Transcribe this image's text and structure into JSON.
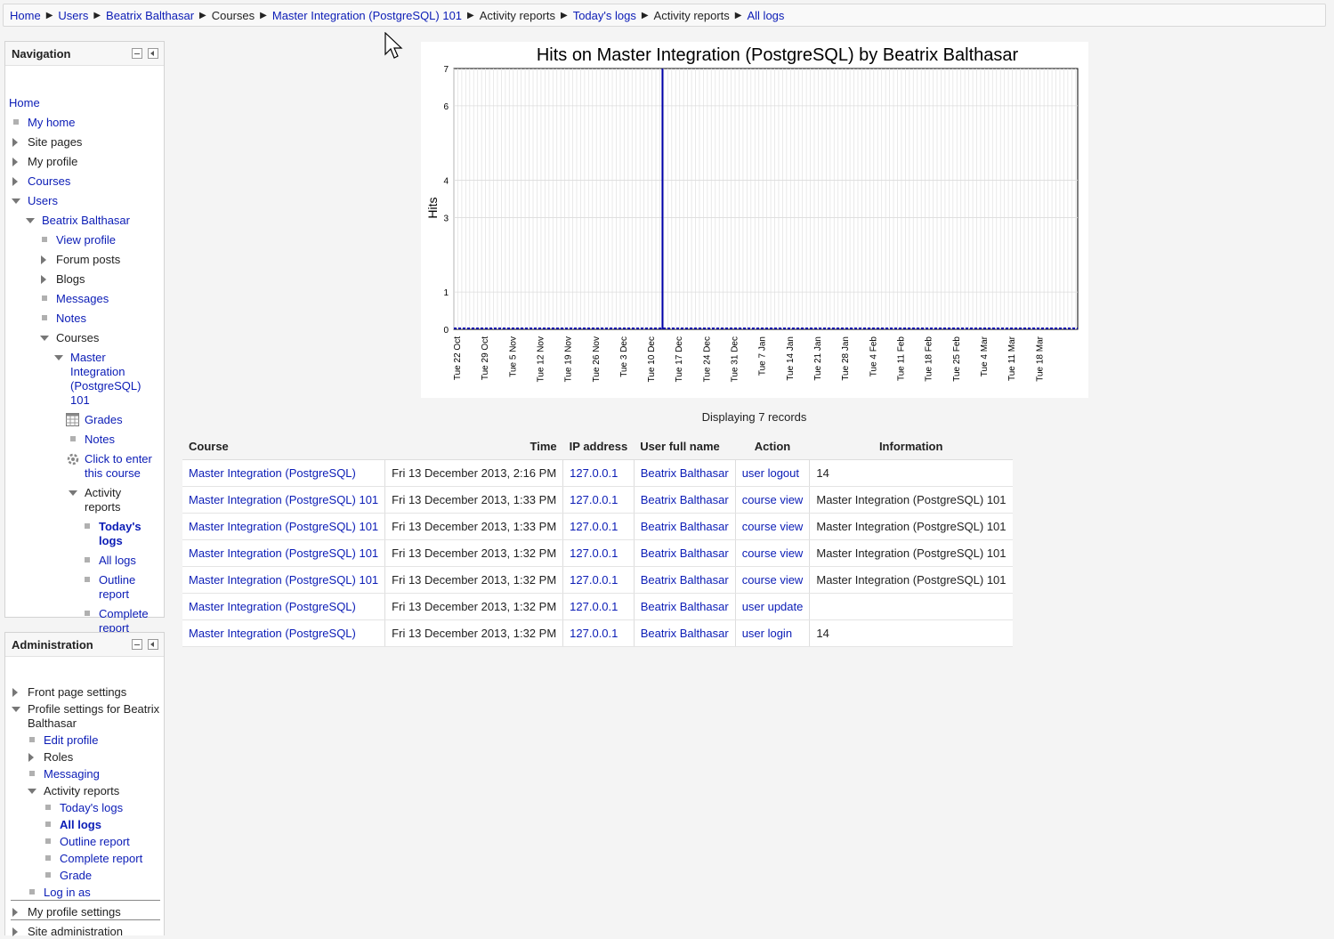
{
  "breadcrumb": [
    {
      "label": "Home",
      "link": true
    },
    {
      "label": "Users",
      "link": true
    },
    {
      "label": "Beatrix Balthasar",
      "link": true
    },
    {
      "label": "Courses",
      "link": false
    },
    {
      "label": "Master Integration (PostgreSQL) 101",
      "link": true
    },
    {
      "label": "Activity reports",
      "link": false
    },
    {
      "label": "Today's logs",
      "link": true
    },
    {
      "label": "Activity reports",
      "link": false
    },
    {
      "label": "All logs",
      "link": true
    }
  ],
  "navigation": {
    "title": "Navigation",
    "home": "Home",
    "items": [
      {
        "label": "My home",
        "marker": "square",
        "depth": 0,
        "link": true
      },
      {
        "label": "Site pages",
        "marker": "right",
        "depth": 0,
        "link": false
      },
      {
        "label": "My profile",
        "marker": "right",
        "depth": 0,
        "link": false
      },
      {
        "label": "Courses",
        "marker": "right",
        "depth": 0,
        "link": true
      },
      {
        "label": "Users",
        "marker": "down",
        "depth": 0,
        "link": true
      },
      {
        "label": "Beatrix Balthasar",
        "marker": "down",
        "depth": 1,
        "link": true
      },
      {
        "label": "View profile",
        "marker": "square",
        "depth": 2,
        "link": true
      },
      {
        "label": "Forum posts",
        "marker": "right",
        "depth": 2,
        "link": false
      },
      {
        "label": "Blogs",
        "marker": "right",
        "depth": 2,
        "link": false
      },
      {
        "label": "Messages",
        "marker": "square",
        "depth": 2,
        "link": true
      },
      {
        "label": "Notes",
        "marker": "square",
        "depth": 2,
        "link": true
      },
      {
        "label": "Courses",
        "marker": "down",
        "depth": 2,
        "link": false
      },
      {
        "label": "Master Integration (PostgreSQL) 101",
        "marker": "down",
        "depth": 3,
        "link": true,
        "lines": [
          "Master",
          "Integration",
          "(PostgreSQL)",
          "101"
        ]
      },
      {
        "label": "Grades",
        "marker": "grid",
        "depth": 4,
        "link": true
      },
      {
        "label": "Notes",
        "marker": "square",
        "depth": 4,
        "link": true
      },
      {
        "label": "Click to enter this course",
        "marker": "gear",
        "depth": 4,
        "link": true,
        "lines": [
          "Click to enter",
          "this course"
        ]
      },
      {
        "label": "Activity reports",
        "marker": "down",
        "depth": 4,
        "link": false,
        "lines": [
          "Activity",
          "reports"
        ]
      },
      {
        "label": "Today's logs",
        "marker": "square",
        "depth": 5,
        "link": true,
        "bold": true,
        "lines": [
          "Today's",
          "logs"
        ]
      },
      {
        "label": "All logs",
        "marker": "square",
        "depth": 5,
        "link": true
      },
      {
        "label": "Outline report",
        "marker": "square",
        "depth": 5,
        "link": true,
        "lines": [
          "Outline",
          "report"
        ]
      },
      {
        "label": "Complete report",
        "marker": "square",
        "depth": 5,
        "link": true,
        "lines": [
          "Complete",
          "report"
        ]
      }
    ]
  },
  "administration": {
    "title": "Administration",
    "items": [
      {
        "label": "Front page settings",
        "marker": "right",
        "depth": 0,
        "link": false
      },
      {
        "label": "Profile settings for Beatrix Balthasar",
        "marker": "down",
        "depth": 0,
        "link": false,
        "lines": [
          "Profile settings for Beatrix",
          "Balthasar"
        ]
      },
      {
        "label": "Edit profile",
        "marker": "square",
        "depth": 1,
        "link": true
      },
      {
        "label": "Roles",
        "marker": "right",
        "depth": 1,
        "link": false
      },
      {
        "label": "Messaging",
        "marker": "square",
        "depth": 1,
        "link": true
      },
      {
        "label": "Activity reports",
        "marker": "down",
        "depth": 1,
        "link": false
      },
      {
        "label": "Today's logs",
        "marker": "square",
        "depth": 2,
        "link": true
      },
      {
        "label": "All logs",
        "marker": "square",
        "depth": 2,
        "link": true,
        "bold": true
      },
      {
        "label": "Outline report",
        "marker": "square",
        "depth": 2,
        "link": true
      },
      {
        "label": "Complete report",
        "marker": "square",
        "depth": 2,
        "link": true
      },
      {
        "label": "Grade",
        "marker": "square",
        "depth": 2,
        "link": true
      },
      {
        "label": "Log in as",
        "marker": "square",
        "depth": 1,
        "link": true
      },
      {
        "label": "My profile settings",
        "marker": "right",
        "depth": 0,
        "link": false
      },
      {
        "label": "Site administration",
        "marker": "right",
        "depth": 0,
        "link": false
      }
    ]
  },
  "chart_data": {
    "type": "bar",
    "title": "Hits on Master Integration (PostgreSQL) by Beatrix Balthasar",
    "ylabel": "Hits",
    "xlabel": "",
    "ylim": [
      0,
      7
    ],
    "yticks": [
      0,
      1,
      3,
      4,
      6,
      7
    ],
    "tick_labels": [
      "Tue 22 Oct",
      "Tue 29 Oct",
      "Tue 5 Nov",
      "Tue 12 Nov",
      "Tue 19 Nov",
      "Tue 26 Nov",
      "Tue 3 Dec",
      "Tue 10 Dec",
      "Tue 17 Dec",
      "Tue 24 Dec",
      "Tue 31 Dec",
      "Tue 7 Jan",
      "Tue 14 Jan",
      "Tue 21 Jan",
      "Tue 28 Jan",
      "Tue 4 Feb",
      "Tue 11 Feb",
      "Tue 18 Feb",
      "Tue 25 Feb",
      "Tue 4 Mar",
      "Tue 11 Mar",
      "Tue 18 Mar"
    ],
    "series": [
      {
        "values": [
          {
            "x": "Fri 13 Dec 2013",
            "y": 7
          }
        ]
      }
    ],
    "grid": true,
    "color": "#0000aa"
  },
  "records_label": "Displaying 7 records",
  "table": {
    "headers": [
      "Course",
      "Time",
      "IP address",
      "User full name",
      "Action",
      "Information"
    ],
    "rows": [
      [
        "Master Integration (PostgreSQL)",
        "Fri 13 December 2013, 2:16 PM",
        "127.0.0.1",
        "Beatrix Balthasar",
        "user logout",
        "14"
      ],
      [
        "Master Integration (PostgreSQL) 101",
        "Fri 13 December 2013, 1:33 PM",
        "127.0.0.1",
        "Beatrix Balthasar",
        "course view",
        "Master Integration (PostgreSQL) 101"
      ],
      [
        "Master Integration (PostgreSQL) 101",
        "Fri 13 December 2013, 1:33 PM",
        "127.0.0.1",
        "Beatrix Balthasar",
        "course view",
        "Master Integration (PostgreSQL) 101"
      ],
      [
        "Master Integration (PostgreSQL) 101",
        "Fri 13 December 2013, 1:32 PM",
        "127.0.0.1",
        "Beatrix Balthasar",
        "course view",
        "Master Integration (PostgreSQL) 101"
      ],
      [
        "Master Integration (PostgreSQL) 101",
        "Fri 13 December 2013, 1:32 PM",
        "127.0.0.1",
        "Beatrix Balthasar",
        "course view",
        "Master Integration (PostgreSQL) 101"
      ],
      [
        "Master Integration (PostgreSQL)",
        "Fri 13 December 2013, 1:32 PM",
        "127.0.0.1",
        "Beatrix Balthasar",
        "user update",
        ""
      ],
      [
        "Master Integration (PostgreSQL)",
        "Fri 13 December 2013, 1:32 PM",
        "127.0.0.1",
        "Beatrix Balthasar",
        "user login",
        "14"
      ]
    ]
  }
}
